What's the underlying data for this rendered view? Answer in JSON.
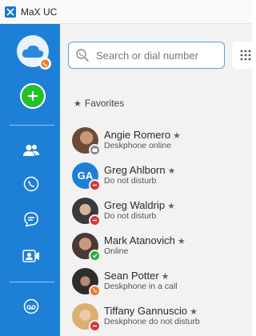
{
  "app": {
    "title": "MaX UC",
    "icon": "max-uc-logo-icon"
  },
  "sidebar": {
    "profile_icon": "cloud-avatar-icon",
    "add_icon": "plus-icon",
    "nav": [
      {
        "name": "contacts",
        "icon": "people-icon"
      },
      {
        "name": "calls",
        "icon": "phone-icon"
      },
      {
        "name": "chat",
        "icon": "chat-bubble-icon"
      },
      {
        "name": "meetings",
        "icon": "video-contact-icon"
      },
      {
        "name": "voicemail",
        "icon": "voicemail-icon"
      }
    ]
  },
  "search": {
    "placeholder": "Search or dial number",
    "value": ""
  },
  "favorites": {
    "header": "Favorites",
    "contacts": [
      {
        "name": "Angie Romero",
        "status": "Deskphone online",
        "presence": "deskphone",
        "initials": ""
      },
      {
        "name": "Greg Ahlborn",
        "status": "Do not disturb",
        "presence": "dnd",
        "initials": "GA"
      },
      {
        "name": "Greg Waldrip",
        "status": "Do not disturb",
        "presence": "dnd",
        "initials": ""
      },
      {
        "name": "Mark Atanovich",
        "status": "Online",
        "presence": "online",
        "initials": ""
      },
      {
        "name": "Sean Potter",
        "status": "Deskphone in a call",
        "presence": "in-call",
        "initials": ""
      },
      {
        "name": "Tiffany Gannuscio",
        "status": "Deskphone do not disturb",
        "presence": "deskphone-dnd",
        "initials": ""
      }
    ]
  },
  "colors": {
    "sidebar": "#1e7fd6",
    "add_button": "#28c028",
    "online": "#2eaa3c",
    "dnd": "#d23a3a",
    "deskphone": "#8a8a8a",
    "in_call": "#f07a2a",
    "search_border": "#5e9fd8"
  }
}
